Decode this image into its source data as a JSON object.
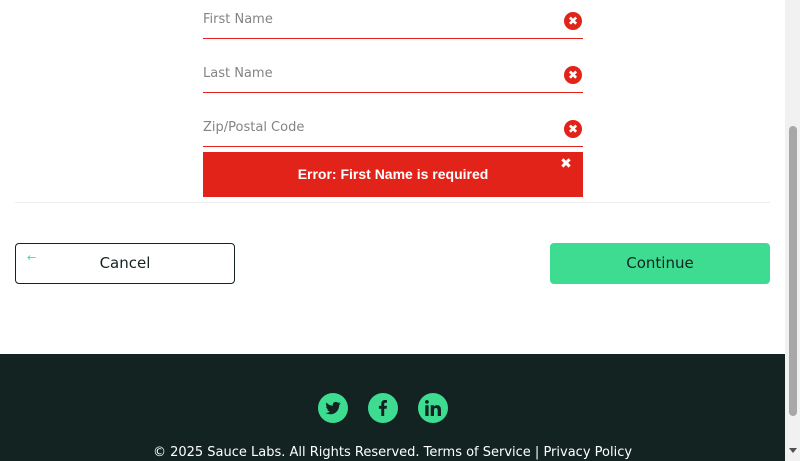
{
  "form": {
    "first_name_placeholder": "First Name",
    "last_name_placeholder": "Last Name",
    "zip_placeholder": "Zip/Postal Code",
    "error_icon_glyph": "✖",
    "error_message": "Error: First Name is required",
    "error_close_glyph": "✖"
  },
  "buttons": {
    "cancel_arrow": "←",
    "cancel_label": "Cancel",
    "continue_label": "Continue"
  },
  "footer": {
    "social": [
      "twitter-icon",
      "facebook-icon",
      "linkedin-icon"
    ],
    "copyright": "© 2025 Sauce Labs. All Rights Reserved. Terms of Service | Privacy Policy"
  },
  "colors": {
    "error_red": "#e2231a",
    "accent_green": "#3ddc91",
    "footer_bg": "#132322"
  }
}
